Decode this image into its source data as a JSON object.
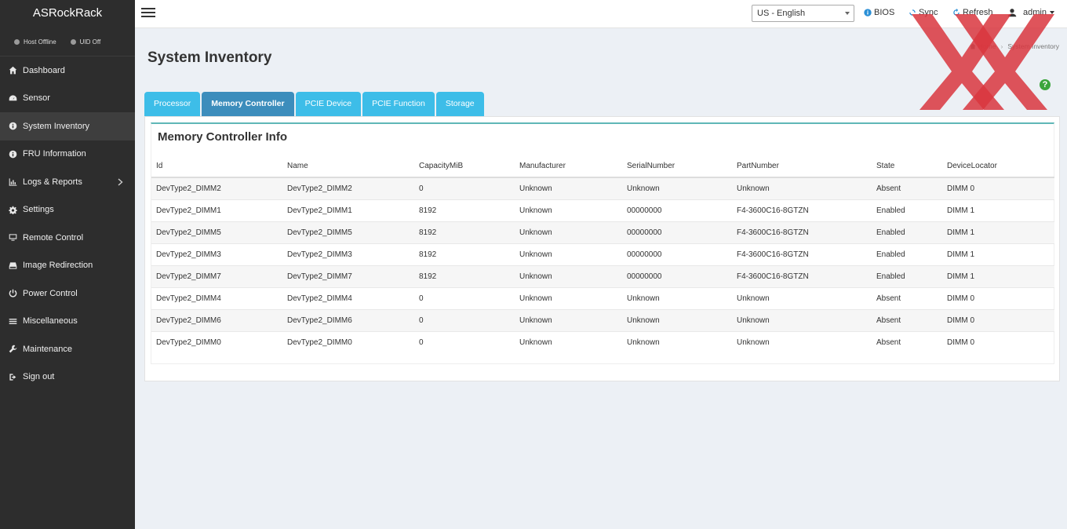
{
  "app": {
    "brand": "ASRockRack",
    "status": {
      "host": "Host Offline",
      "uid": "UID Off"
    }
  },
  "sidebar": {
    "items": [
      {
        "label": "Dashboard",
        "icon": "dashboard-icon"
      },
      {
        "label": "Sensor",
        "icon": "sensor-icon"
      },
      {
        "label": "System Inventory",
        "icon": "info-icon",
        "active": true
      },
      {
        "label": "FRU Information",
        "icon": "info-icon"
      },
      {
        "label": "Logs & Reports",
        "icon": "chart-icon",
        "has_submenu": true
      },
      {
        "label": "Settings",
        "icon": "gear-icon"
      },
      {
        "label": "Remote Control",
        "icon": "monitor-icon"
      },
      {
        "label": "Image Redirection",
        "icon": "drive-icon"
      },
      {
        "label": "Power Control",
        "icon": "power-icon"
      },
      {
        "label": "Miscellaneous",
        "icon": "list-icon"
      },
      {
        "label": "Maintenance",
        "icon": "wrench-icon"
      },
      {
        "label": "Sign out",
        "icon": "signout-icon"
      }
    ]
  },
  "header": {
    "language": "US - English",
    "bios": "BIOS",
    "sync": "Sync",
    "refresh": "Refresh",
    "user": "admin"
  },
  "page": {
    "title": "System Inventory",
    "breadcrumb": {
      "home": "Home",
      "current": "System Inventory"
    }
  },
  "tabs": [
    {
      "label": "Processor"
    },
    {
      "label": "Memory Controller",
      "active": true
    },
    {
      "label": "PCIE Device"
    },
    {
      "label": "PCIE Function"
    },
    {
      "label": "Storage"
    }
  ],
  "section": {
    "title": "Memory Controller Info"
  },
  "table": {
    "columns": [
      "Id",
      "Name",
      "CapacityMiB",
      "Manufacturer",
      "SerialNumber",
      "PartNumber",
      "State",
      "DeviceLocator"
    ],
    "rows": [
      [
        "DevType2_DIMM2",
        "DevType2_DIMM2",
        "0",
        "Unknown",
        "Unknown",
        "Unknown",
        "Absent",
        "DIMM 0"
      ],
      [
        "DevType2_DIMM1",
        "DevType2_DIMM1",
        "8192",
        "Unknown",
        "00000000",
        "F4-3600C16-8GTZN",
        "Enabled",
        "DIMM 1"
      ],
      [
        "DevType2_DIMM5",
        "DevType2_DIMM5",
        "8192",
        "Unknown",
        "00000000",
        "F4-3600C16-8GTZN",
        "Enabled",
        "DIMM 1"
      ],
      [
        "DevType2_DIMM3",
        "DevType2_DIMM3",
        "8192",
        "Unknown",
        "00000000",
        "F4-3600C16-8GTZN",
        "Enabled",
        "DIMM 1"
      ],
      [
        "DevType2_DIMM7",
        "DevType2_DIMM7",
        "8192",
        "Unknown",
        "00000000",
        "F4-3600C16-8GTZN",
        "Enabled",
        "DIMM 1"
      ],
      [
        "DevType2_DIMM4",
        "DevType2_DIMM4",
        "0",
        "Unknown",
        "Unknown",
        "Unknown",
        "Absent",
        "DIMM 0"
      ],
      [
        "DevType2_DIMM6",
        "DevType2_DIMM6",
        "0",
        "Unknown",
        "Unknown",
        "Unknown",
        "Absent",
        "DIMM 0"
      ],
      [
        "DevType2_DIMM0",
        "DevType2_DIMM0",
        "0",
        "Unknown",
        "Unknown",
        "Unknown",
        "Absent",
        "DIMM 0"
      ]
    ]
  },
  "colors": {
    "sidebar_bg": "#2d2d2d",
    "tab": "#3dbde8",
    "tab_active": "#3c8dbc",
    "section_border": "#5fb7b7",
    "watermark": "#d9363e"
  }
}
